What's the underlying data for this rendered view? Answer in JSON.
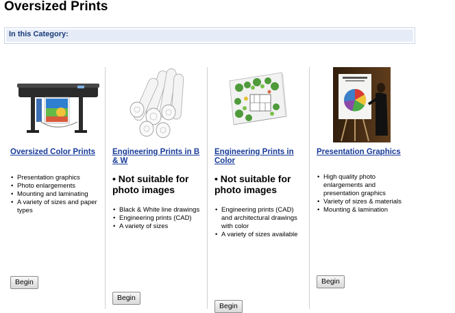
{
  "page": {
    "title": "Oversized Prints"
  },
  "category_box": {
    "label": "In this Category:"
  },
  "products": [
    {
      "title": "Oversized Color Prints",
      "image_icon": "large-format-printer",
      "warning": "",
      "bullets": [
        "Presentation graphics",
        "Photo enlargements",
        "Mounting and laminating",
        "A variety of sizes and paper types"
      ],
      "button": "Begin"
    },
    {
      "title": "Engineering Prints in B & W",
      "image_icon": "rolled-blueprints",
      "warning": "• Not suitable for photo images",
      "bullets": [
        "Black & White line drawings",
        "Engineering prints (CAD)",
        "A variety of sizes"
      ],
      "button": "Begin"
    },
    {
      "title": "Engineering Prints in Color",
      "image_icon": "color-site-plan",
      "warning": "• Not suitable for photo images",
      "bullets": [
        "Engineering prints (CAD) and architectural drawings with color",
        "A variety of sizes available"
      ],
      "button": "Begin"
    },
    {
      "title": "Presentation Graphics",
      "image_icon": "presentation-easel",
      "warning": "",
      "bullets": [
        "High quality photo enlargements and presentation graphics",
        "Variety of sizes & materials",
        "Mounting & lamination"
      ],
      "button": "Begin"
    }
  ]
}
